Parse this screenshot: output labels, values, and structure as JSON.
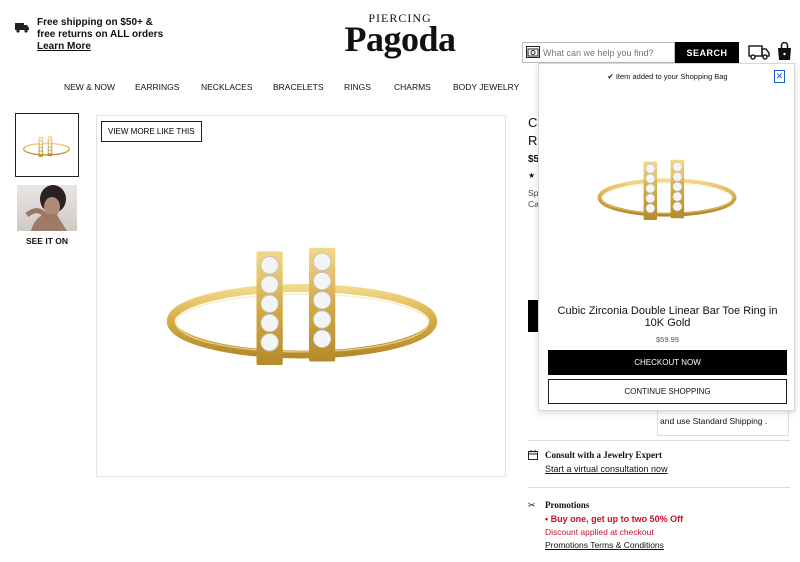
{
  "header": {
    "shipping_line1": "Free shipping on $50+ &",
    "shipping_line2": "free returns on ALL orders",
    "learn_more": "Learn More",
    "logo_small": "PIERCING",
    "logo_big": "Pagoda",
    "search_placeholder": "What can we help you find?",
    "search_button": "SEARCH"
  },
  "nav": {
    "items": [
      "NEW & NOW",
      "EARRINGS",
      "NECKLACES",
      "BRACELETS",
      "RINGS",
      "CHARMS",
      "BODY JEWELRY"
    ]
  },
  "gallery": {
    "see_it_on": "SEE IT ON",
    "view_more": "VIEW MORE LIKE THIS"
  },
  "behind_popup": {
    "title_c": "C",
    "title_r": "R",
    "price_frag": "$5",
    "frag1": "Sp",
    "frag2": "Ca",
    "standard_shipping": "and use Standard Shipping .",
    "consult_title": "Consult with a Jewelry Expert",
    "consult_link": "Start a virtual consultation now",
    "promo_title": "Promotions",
    "promo_offer": "Buy one, get up to two 50% Off",
    "promo_discount": "Discount applied at checkout",
    "promo_terms": "Promotions Terms & Conditions"
  },
  "popup": {
    "message": "Item added to your Shopping Bag",
    "product_name": "Cubic Zirconia Double Linear Bar Toe Ring in 10K Gold",
    "price": "$59.99",
    "checkout": "CHECKOUT NOW",
    "continue": "CONTINUE SHOPPING"
  },
  "colors": {
    "gold": "#d9b451",
    "promo_red": "#c8102e",
    "black": "#000000"
  },
  "icons": [
    "truck-icon",
    "camera-icon",
    "shopping-bag-icon",
    "checkmark-icon",
    "close-icon",
    "calendar-icon",
    "scissors-icon"
  ]
}
